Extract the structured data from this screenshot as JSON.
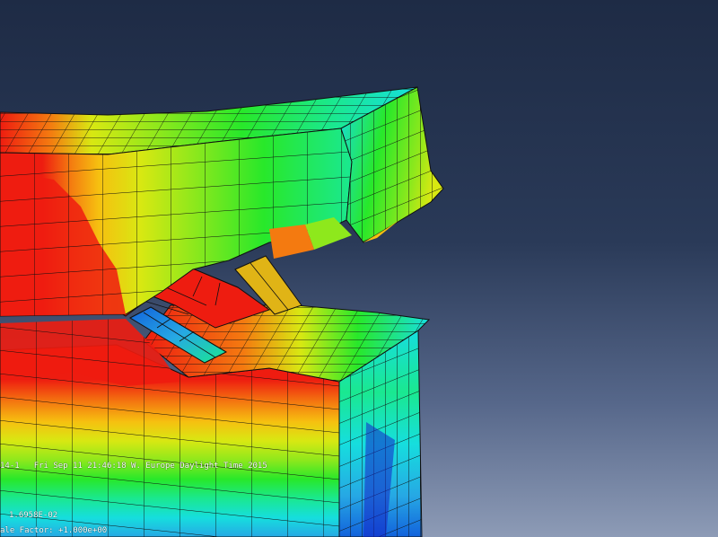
{
  "viewport": {
    "status_step": "14-1",
    "status_timestamp": "Fri Sep 11 21:46:18 W. Europe Daylight Time 2015",
    "legend_min_value": "1.6958E-02",
    "scale_factor": "ale Factor: +1.000e+00",
    "colors": {
      "red": "#ee1c10",
      "orange": "#f47a10",
      "yellow_orange": "#f6c010",
      "yellow": "#d8e812",
      "lime": "#8ee81c",
      "green": "#28e82a",
      "mint": "#1ae890",
      "cyan": "#16dede",
      "light_blue": "#26a8e4",
      "blue": "#1262dc",
      "dark_blue": "#1424c8"
    }
  }
}
